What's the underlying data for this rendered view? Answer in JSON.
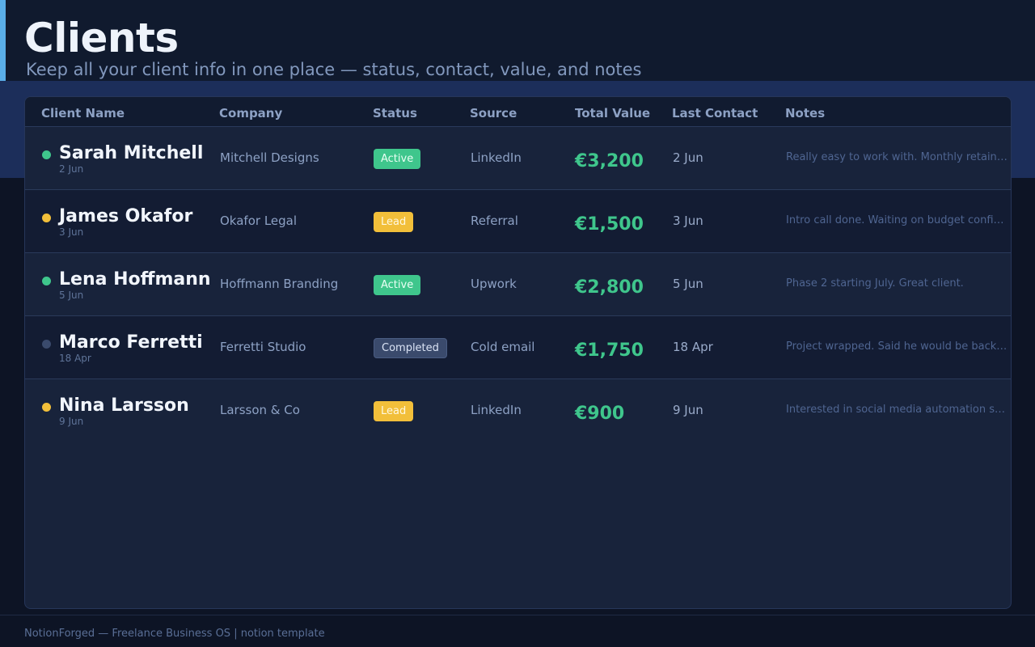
{
  "header": {
    "title": "Clients",
    "subtitle": "Keep all your client info in one place — status, contact, value, and notes"
  },
  "table": {
    "columns": [
      "Client Name",
      "Company",
      "Status",
      "Source",
      "Total Value",
      "Last Contact",
      "Notes"
    ],
    "rows": [
      {
        "name": "Sarah Mitchell",
        "added": "2 Jun",
        "company": "Mitchell Designs",
        "status": "Active",
        "source": "LinkedIn",
        "value": "€3,200",
        "last_contact": "2 Jun",
        "notes": "Really easy to work with. Monthly retainer"
      },
      {
        "name": "James Okafor",
        "added": "3 Jun",
        "company": "Okafor Legal",
        "status": "Lead",
        "source": "Referral",
        "value": "€1,500",
        "last_contact": "3 Jun",
        "notes": "Intro call done. Waiting on budget confirmation"
      },
      {
        "name": "Lena Hoffmann",
        "added": "5 Jun",
        "company": "Hoffmann Branding",
        "status": "Active",
        "source": "Upwork",
        "value": "€2,800",
        "last_contact": "5 Jun",
        "notes": "Phase 2 starting July. Great client."
      },
      {
        "name": "Marco Ferretti",
        "added": "18 Apr",
        "company": "Ferretti Studio",
        "status": "Completed",
        "source": "Cold email",
        "value": "€1,750",
        "last_contact": "18 Apr",
        "notes": "Project wrapped. Said he would be back in autumn"
      },
      {
        "name": "Nina Larsson",
        "added": "9 Jun",
        "company": "Larsson & Co",
        "status": "Lead",
        "source": "LinkedIn",
        "value": "€900",
        "last_contact": "9 Jun",
        "notes": "Interested in social media automation setup"
      }
    ]
  },
  "status_colors": {
    "Active": "#3fc68c",
    "Lead": "#f2bf3a",
    "Completed": "#3a4a6c"
  },
  "footer": {
    "text": "NotionForged — Freelance Business OS  |  notion template"
  }
}
